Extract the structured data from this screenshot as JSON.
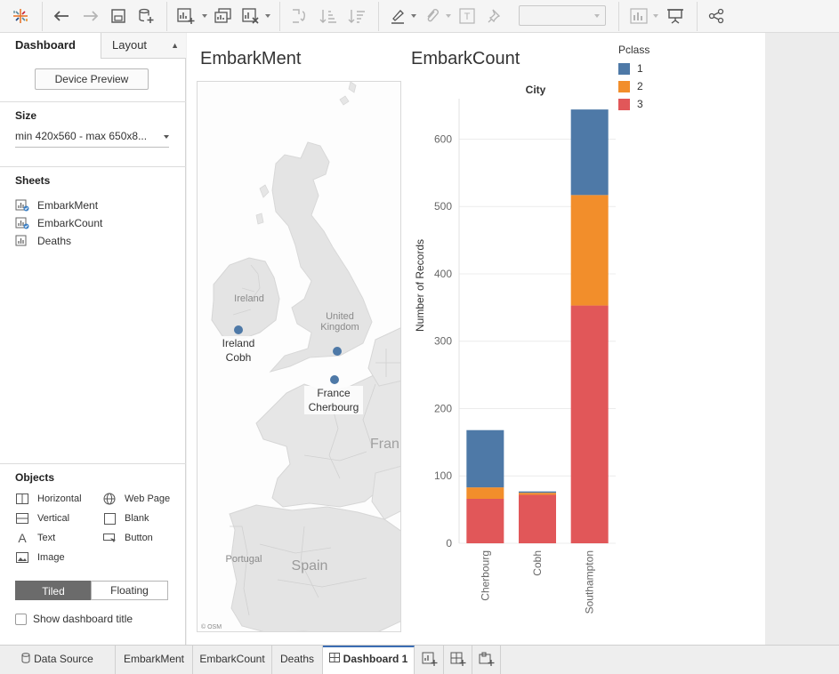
{
  "toolbar": {
    "icons": [
      "tableau-logo-icon",
      "undo-icon",
      "redo-icon",
      "save-icon",
      "new-data-source-icon",
      "new-worksheet-icon",
      "duplicate-sheet-icon",
      "clear-sheet-icon",
      "swap-rows-columns-icon",
      "sort-ascending-icon",
      "sort-descending-icon",
      "highlight-icon",
      "group-members-icon",
      "show-mark-labels-icon",
      "fix-axes-icon",
      "fit-dropdown",
      "show-me-icon",
      "presentation-mode-icon",
      "share-icon"
    ],
    "fit_value": ""
  },
  "left_panel": {
    "tab_dashboard": "Dashboard",
    "tab_layout": "Layout",
    "device_preview": "Device Preview",
    "size_title": "Size",
    "size_value": "min 420x560 - max 650x8...",
    "sheets_title": "Sheets",
    "sheets": [
      {
        "label": "EmbarkMent",
        "in_use": true
      },
      {
        "label": "EmbarkCount",
        "in_use": true
      },
      {
        "label": "Deaths",
        "in_use": false
      }
    ],
    "objects_title": "Objects",
    "objects": [
      {
        "label": "Horizontal",
        "icon": "horizontal-container-icon"
      },
      {
        "label": "Web Page",
        "icon": "globe-icon"
      },
      {
        "label": "Vertical",
        "icon": "vertical-container-icon"
      },
      {
        "label": "Blank",
        "icon": "blank-icon"
      },
      {
        "label": "Text",
        "icon": "text-icon"
      },
      {
        "label": "Button",
        "icon": "button-icon"
      },
      {
        "label": "Image",
        "icon": "image-icon"
      }
    ],
    "tiled": "Tiled",
    "floating": "Floating",
    "show_title": "Show dashboard title"
  },
  "dashboard": {
    "map_title": "EmbarkMent",
    "chart_title": "EmbarkCount",
    "map": {
      "labels": {
        "ireland": "Ireland",
        "uk_1": "United",
        "uk_2": "Kingdom",
        "france_partial": "Fran",
        "spain": "Spain",
        "portugal": "Portugal",
        "osm": "© OSM"
      },
      "points": [
        {
          "line1": "Ireland",
          "line2": "Cobh"
        },
        {
          "line1": "",
          "line2": ""
        },
        {
          "line1": "France",
          "line2": "Cherbourg"
        }
      ]
    },
    "legend": {
      "title": "Pclass",
      "items": [
        {
          "label": "1",
          "color": "#4e79a7"
        },
        {
          "label": "2",
          "color": "#f28e2b"
        },
        {
          "label": "3",
          "color": "#e15759"
        }
      ]
    }
  },
  "chart_data": {
    "type": "bar",
    "stacked": true,
    "title": "",
    "header": "City",
    "xlabel": "",
    "ylabel": "Number of Records",
    "categories": [
      "Cherbourg",
      "Cobh",
      "Southampton"
    ],
    "series": [
      {
        "name": "1",
        "color": "#4e79a7",
        "values": [
          85,
          2,
          127
        ]
      },
      {
        "name": "2",
        "color": "#f28e2b",
        "values": [
          17,
          3,
          164
        ]
      },
      {
        "name": "3",
        "color": "#e15759",
        "values": [
          66,
          72,
          353
        ]
      }
    ],
    "yticks": [
      0,
      100,
      200,
      300,
      400,
      500,
      600
    ],
    "ylim": [
      0,
      660
    ],
    "grid": true,
    "legend": "top-right"
  },
  "bottom_tabs": {
    "data_source": "Data Source",
    "sheets": [
      "EmbarkMent",
      "EmbarkCount",
      "Deaths"
    ],
    "dashboard": "Dashboard 1",
    "icons": [
      "new-worksheet-icon",
      "new-dashboard-icon",
      "new-story-icon"
    ]
  }
}
